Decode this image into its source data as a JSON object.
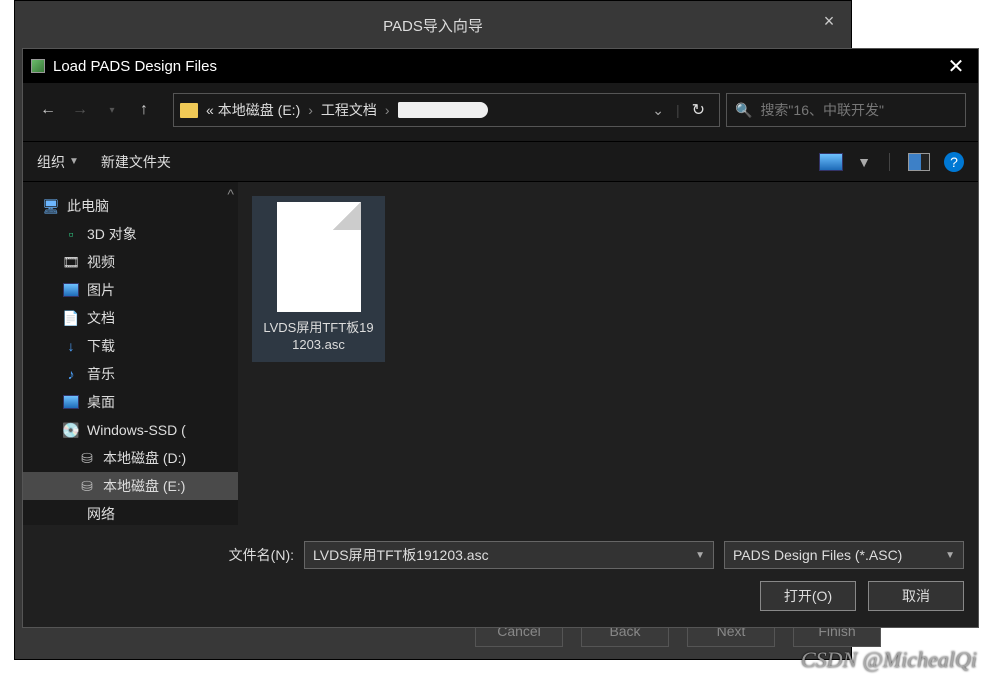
{
  "wizard": {
    "title": "PADS导入向导",
    "buttons": {
      "cancel": "Cancel",
      "back": "Back",
      "next": "Next",
      "finish": "Finish"
    }
  },
  "dialog": {
    "title": "Load PADS Design Files",
    "breadcrumb": {
      "prefix": "«",
      "drive": "本地磁盘 (E:)",
      "folder": "工程文档"
    },
    "search_placeholder": "搜索\"16、中联开发\"",
    "toolbar": {
      "organize": "组织",
      "new_folder": "新建文件夹"
    },
    "sidebar": {
      "items": [
        {
          "label": "此电脑",
          "icon": "ic-pc",
          "lvl": ""
        },
        {
          "label": "3D 对象",
          "icon": "ic-3d",
          "lvl": "l2"
        },
        {
          "label": "视频",
          "icon": "ic-vid",
          "lvl": "l2"
        },
        {
          "label": "图片",
          "icon": "ic-img",
          "lvl": "l2"
        },
        {
          "label": "文档",
          "icon": "ic-doc",
          "lvl": "l2"
        },
        {
          "label": "下载",
          "icon": "ic-dl",
          "lvl": "l2"
        },
        {
          "label": "音乐",
          "icon": "ic-music",
          "lvl": "l2"
        },
        {
          "label": "桌面",
          "icon": "ic-desk",
          "lvl": "l2"
        },
        {
          "label": "Windows-SSD (",
          "icon": "ic-ssd",
          "lvl": "l2"
        },
        {
          "label": "本地磁盘 (D:)",
          "icon": "ic-drv",
          "lvl": "l3"
        },
        {
          "label": "本地磁盘 (E:)",
          "icon": "ic-drv",
          "lvl": "l3",
          "selected": true
        },
        {
          "label": "网络",
          "icon": "",
          "lvl": "l2"
        }
      ]
    },
    "file": {
      "name": "LVDS屏用TFT板191203.asc"
    },
    "filename_label": "文件名(N):",
    "filename_value": "LVDS屏用TFT板191203.asc",
    "filetype": "PADS Design Files (*.ASC)",
    "open": "打开(O)",
    "cancel": "取消"
  },
  "watermark": "CSDN @MichealQi"
}
